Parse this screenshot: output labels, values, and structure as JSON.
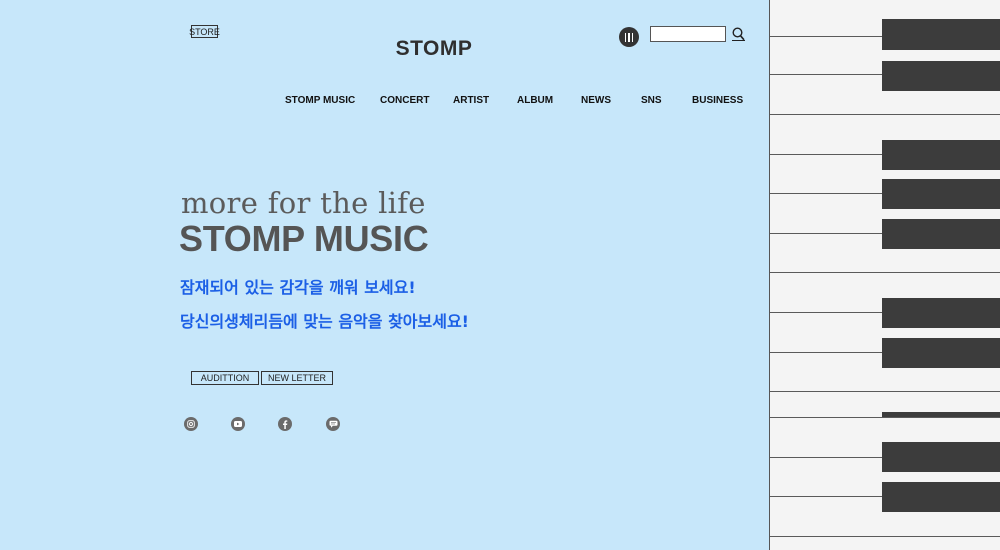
{
  "header": {
    "store_label": "STORE",
    "logo": "STOMP",
    "search": {
      "value": "",
      "placeholder": ""
    }
  },
  "nav": {
    "items": [
      {
        "label": "STOMP MUSIC"
      },
      {
        "label": "CONCERT"
      },
      {
        "label": "ARTIST"
      },
      {
        "label": "ALBUM"
      },
      {
        "label": "NEWS"
      },
      {
        "label": "SNS"
      },
      {
        "label": "BUSINESS"
      }
    ]
  },
  "hero": {
    "tagline": "more for the life",
    "headline": "STOMP MUSIC",
    "line1": "잠재되어 있는 감각을 깨워 보세요!",
    "line2": "당신의생체리듬에 맞는 음악을 찾아보세요!"
  },
  "buttons": {
    "audition": "AUDITTION",
    "newsletter": "NEW LETTER"
  },
  "social": [
    {
      "icon": "instagram-icon"
    },
    {
      "icon": "youtube-icon"
    },
    {
      "icon": "facebook-icon"
    },
    {
      "icon": "chat-icon"
    }
  ],
  "colors": {
    "background": "#c7e7fa",
    "accent_text": "#1b5fe6",
    "piano_black": "#3c3c3c",
    "piano_white": "#f4f4f4"
  }
}
